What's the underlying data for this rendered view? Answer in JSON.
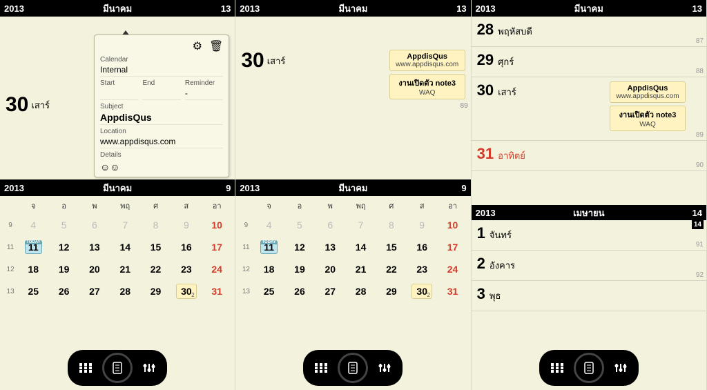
{
  "header": {
    "year": "2013",
    "month": "มีนาคม",
    "day": "13"
  },
  "header2": {
    "year": "2013",
    "month": "มีนาคม",
    "day": "9"
  },
  "header3": {
    "year": "2013",
    "month": "เมษายน",
    "day": "14",
    "badge": "14"
  },
  "focus": {
    "daynum": "30",
    "dayname": "เสาร์"
  },
  "card": {
    "calendar_lbl": "Calendar",
    "calendar_val": "Internal",
    "start_lbl": "Start",
    "end_lbl": "End",
    "reminder_lbl": "Reminder",
    "reminder_val": "-",
    "subject_lbl": "Subject",
    "subject_val": "AppdisQus",
    "location_lbl": "Location",
    "location_val": "www.appdisqus.com",
    "details_lbl": "Details",
    "emoji": "☺☺"
  },
  "events": [
    {
      "title": "AppdisQus",
      "sub": "www.appdisqus.com"
    },
    {
      "title": "งานเปิดตัว note3",
      "sub": "WAQ"
    }
  ],
  "wknum_p2": "89",
  "dow": [
    "",
    "จ",
    "อ",
    "พ",
    "พฤ",
    "ศ",
    "ส",
    "อา"
  ],
  "today_label": "TODAY",
  "weeks": [
    {
      "wk": "9",
      "d": [
        "4",
        "5",
        "6",
        "7",
        "8",
        "9",
        "10"
      ],
      "dim_to": 5,
      "sun_idx": 6
    },
    {
      "wk": "11",
      "d": [
        "11",
        "12",
        "13",
        "14",
        "15",
        "16",
        "17"
      ],
      "today_idx": 0,
      "sun_idx": 6
    },
    {
      "wk": "12",
      "d": [
        "18",
        "19",
        "20",
        "21",
        "22",
        "23",
        "24"
      ],
      "sun_idx": 6
    },
    {
      "wk": "13",
      "d": [
        "25",
        "26",
        "27",
        "28",
        "29",
        "30",
        "31"
      ],
      "sel_idx": 5,
      "sel_cnt": "2",
      "sun_idx": 6
    }
  ],
  "agenda": [
    {
      "n": "28",
      "w": "พฤหัสบดี",
      "wk": "87"
    },
    {
      "n": "29",
      "w": "ศุกร์",
      "wk": "88"
    },
    {
      "n": "30",
      "w": "เสาร์",
      "wk": "89",
      "big": true,
      "events": true
    },
    {
      "n": "31",
      "w": "อาทิตย์",
      "wk": "90",
      "sun": true
    }
  ],
  "agenda2": [
    {
      "n": "1",
      "w": "จันทร์",
      "wk": "91"
    },
    {
      "n": "2",
      "w": "อังคาร",
      "wk": "92"
    },
    {
      "n": "3",
      "w": "พุธ",
      "wk": ""
    }
  ]
}
